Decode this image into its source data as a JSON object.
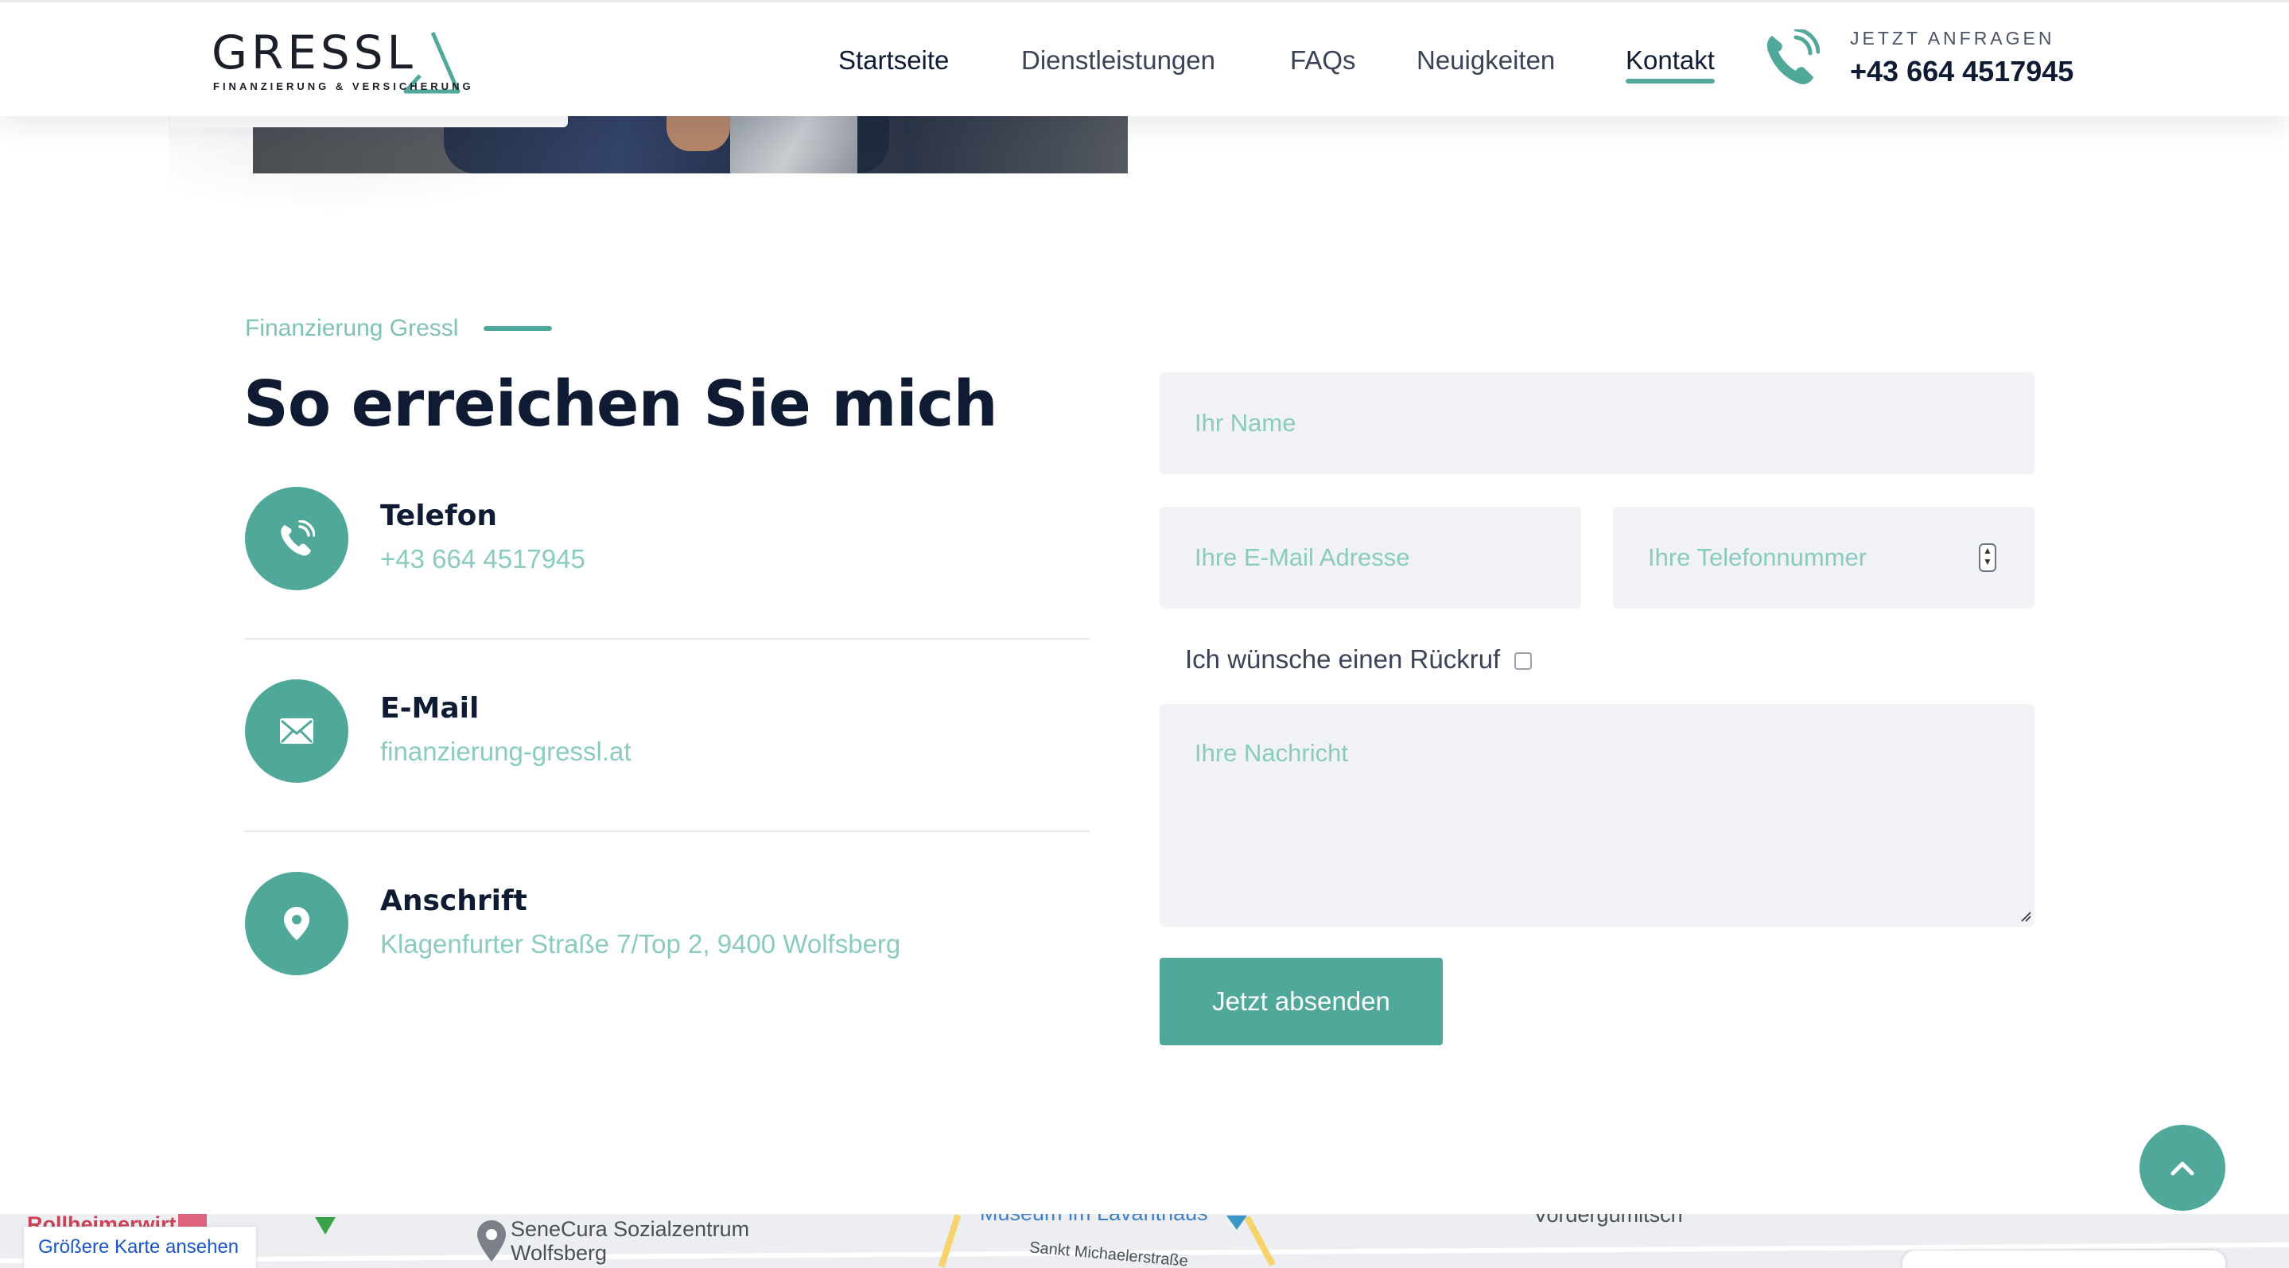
{
  "header": {
    "logo_word": "GRESSL",
    "logo_sub": "FINANZIERUNG & VERSICHERUNG",
    "nav": [
      {
        "label": "Startseite"
      },
      {
        "label": "Dienstleistungen"
      },
      {
        "label": "FAQs"
      },
      {
        "label": "Neuigkeiten"
      },
      {
        "label": "Kontakt"
      }
    ],
    "cta_label": "JETZT ANFRAGEN",
    "cta_number": "+43 664 4517945"
  },
  "contact": {
    "eyebrow": "Finanzierung Gressl",
    "title": "So erreichen Sie mich",
    "items": [
      {
        "label": "Telefon",
        "value": "+43 664 4517945",
        "icon": "phone-icon"
      },
      {
        "label": "E-Mail",
        "value": "finanzierung-gressl.at",
        "icon": "mail-icon"
      },
      {
        "label": "Anschrift",
        "value": "Klagenfurter Straße 7/Top 2, 9400 Wolfsberg",
        "icon": "location-pin-icon"
      }
    ]
  },
  "form": {
    "name_placeholder": "Ihr Name",
    "email_placeholder": "Ihre E-Mail Adresse",
    "phone_placeholder": "Ihre Telefonnummer",
    "callback_label": "Ich wünsche einen Rückruf",
    "callback_checked": false,
    "message_placeholder": "Ihre Nachricht",
    "submit_label": "Jetzt absenden"
  },
  "map": {
    "larger_map_link": "Größere Karte ansehen",
    "labels": {
      "partial_red": "Rollheimerwirt",
      "senecura_line1": "SeneCura Sozialzentrum",
      "senecura_line2": "Wolfsberg",
      "museum": "Museum im Lavanthaus",
      "street": "Sankt Michaelerstraße",
      "village": "Vordergumitsch"
    }
  },
  "colors": {
    "accent": "#4fa899",
    "accent_light_text": "#8acbbf",
    "heading": "#0f1b33",
    "field_bg": "#f0f2f5"
  }
}
